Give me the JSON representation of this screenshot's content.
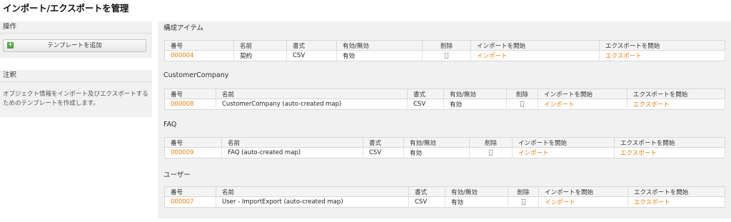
{
  "page_title": "インポート/エクスポートを管理",
  "sidebar": {
    "actions": {
      "title": "操作",
      "add_template_button": "テンプレートを追加"
    },
    "notes": {
      "title": "注釈",
      "text": "オブジェクト情報をインポート及びエクスポートするためのテンプレートを作成します。"
    }
  },
  "sections": [
    {
      "title": "構成アイテム",
      "headers": [
        "番号",
        "名前",
        "書式",
        "有効/無効",
        "削除",
        "インポートを開始",
        "エクスポートを開始"
      ],
      "row": {
        "number": "000004",
        "name": "契約",
        "format": "CSV",
        "validity": "有効",
        "import": "インポート",
        "export": "エクスポート"
      }
    },
    {
      "title": "CustomerCompany",
      "headers": [
        "番号",
        "名前",
        "書式",
        "有効/無効",
        "削除",
        "インポートを開始",
        "エクスポートを開始"
      ],
      "row": {
        "number": "000008",
        "name": "CustomerCompany (auto-created map)",
        "format": "CSV",
        "validity": "有効",
        "import": "インポート",
        "export": "エクスポート"
      }
    },
    {
      "title": "FAQ",
      "headers": [
        "番号",
        "名前",
        "書式",
        "有効/無効",
        "削除",
        "インポートを開始",
        "エクスポートを開始"
      ],
      "row": {
        "number": "000009",
        "name": "FAQ (auto-created map)",
        "format": "CSV",
        "validity": "有効",
        "import": "インポート",
        "export": "エクスポート"
      }
    },
    {
      "title": "ユーザー",
      "headers": [
        "番号",
        "名前",
        "書式",
        "有効/無効",
        "削除",
        "インポートを開始",
        "エクスポートを開始"
      ],
      "row": {
        "number": "000007",
        "name": "User - ImportExport (auto-created map)",
        "format": "CSV",
        "validity": "有効",
        "import": "インポート",
        "export": "エクスポート"
      }
    }
  ],
  "colors": {
    "link": "#f17c0a",
    "panel_bg": "#f1f1f1",
    "add_icon": "#4aa53a"
  },
  "icons": {
    "add": "plus-icon",
    "delete": "trash-icon"
  }
}
